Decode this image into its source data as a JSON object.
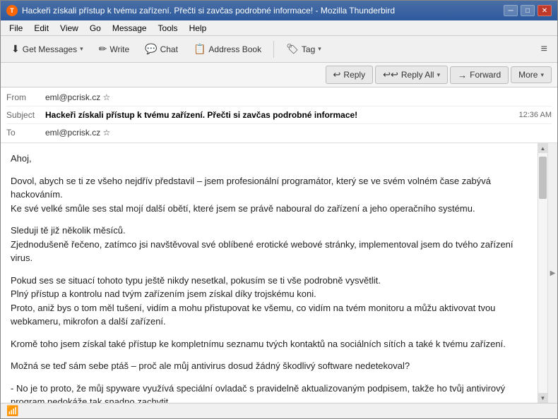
{
  "window": {
    "title": "Hackeři získali přístup k tvému zařízení. Přečti si zavčas podrobné informace! - Mozilla Thunderbird"
  },
  "titlebar": {
    "icon_label": "T",
    "minimize": "─",
    "maximize": "□",
    "close": "✕"
  },
  "menubar": {
    "items": [
      "File",
      "Edit",
      "View",
      "Go",
      "Message",
      "Tools",
      "Help"
    ]
  },
  "toolbar": {
    "get_messages": "Get Messages",
    "write": "Write",
    "chat": "Chat",
    "address_book": "Address Book",
    "tag": "Tag",
    "hamburger": "≡"
  },
  "actions": {
    "reply": "Reply",
    "reply_all": "Reply All",
    "forward": "Forward",
    "more": "More"
  },
  "email": {
    "from_label": "From",
    "from_value": "eml@pcrisk.cz ☆",
    "subject_label": "Subject",
    "subject_value": "Hackeři získali přístup k tvému zařízení. Přečti si zavčas podrobné informace!",
    "to_label": "To",
    "to_value": "eml@pcrisk.cz ☆",
    "time": "12:36 AM",
    "body_paragraphs": [
      "Ahoj,",
      "Dovol, abych se ti ze všeho nejdřív představil – jsem profesionální programátor, který se ve svém volném čase zabývá hackováním.\nKe své velké smůle ses stal mojí další obětí, které jsem se právě naboural do zařízení a jeho operačního systému.",
      "Sleduji tě již několik měsíců.\nZjednodušeně řečeno, zatímco jsi navštěvoval své oblíbené erotické webové stránky, implementoval jsem do tvého zařízení virus.",
      "Pokud ses se situací tohoto typu ještě nikdy nesetkal, pokusím se ti vše podrobně vysvětlit.\nPlný přístup a kontrolu nad tvým zařízením jsem získal díky trojskému koni.\nProto, aniž bys o tom měl tušení, vidím a mohu přistupovat ke všemu, co vidím na tvém monitoru a můžu aktivovat tvou webkameru, mikrofon a další zařízení.",
      "Kromě toho jsem získal také přístup ke kompletnímu seznamu tvých kontaktů na sociálních sítích a také k tvému zařízení.",
      "Možná se teď sám sebe ptáš – proč ale můj antivirus dosud žádný škodlivý software nedetekoval?",
      "- No je to proto, že můj spyware využívá speciální ovladač s pravidelně aktualizovaným podpisem, takže ho tvůj antivirový program nedokáže tak snadno zachytit."
    ]
  },
  "statusbar": {
    "wifi_icon": "📶"
  }
}
